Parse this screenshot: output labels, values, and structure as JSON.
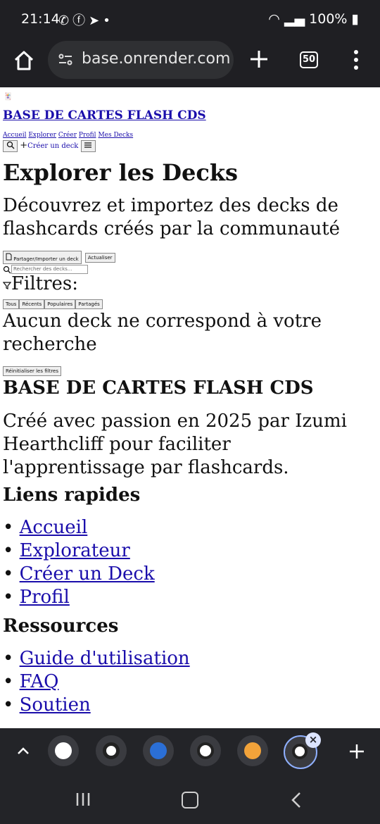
{
  "status": {
    "time": "21:14",
    "notifications": [
      "whatsapp-icon",
      "facebook-icon",
      "telegram-icon",
      "dot-icon"
    ],
    "battery": "100%"
  },
  "browser": {
    "url": "base.onrender.com",
    "tab_count": "50",
    "accent": "#8fb0ff",
    "bar_color": "#1f1f23"
  },
  "site": {
    "favicon": "🃏",
    "title": "BASE DE CARTES FLASH CDS",
    "nav": [
      "Accueil",
      "Explorer",
      "Créer",
      "Profil",
      "Mes Decks"
    ],
    "create_link": "Créer un deck"
  },
  "page": {
    "heading": "Explorer les Decks",
    "subtitle": "Découvrez et importez des decks de flashcards créés par la communauté",
    "share_button": "Partager/Importer un deck",
    "refresh_button": "Actualiser",
    "search_placeholder": "Rechercher des decks...",
    "filters_label": "Filtres:",
    "filter_tabs": [
      "Tous",
      "Récents",
      "Populaires",
      "Partagés"
    ],
    "empty_message": "Aucun deck ne correspond à votre recherche",
    "reset_button": "Réinitialiser les filtres"
  },
  "footer": {
    "title": "BASE DE CARTES FLASH CDS",
    "description": "Créé avec passion en 2025 par Izumi Hearthcliff pour faciliter l'apprentissage par flashcards.",
    "quick_links_title": "Liens rapides",
    "quick_links": [
      "Accueil",
      "Explorateur",
      "Créer un Deck",
      "Profil"
    ],
    "resources_title": "Ressources",
    "resources": [
      "Guide d'utilisation",
      "FAQ",
      "Soutien"
    ]
  },
  "tab_strip": {
    "tabs": [
      "white-circle-icon",
      "globe-icon",
      "butterfly-icon",
      "ticket-icon",
      "heart-icon",
      "heart-outline-icon"
    ]
  }
}
